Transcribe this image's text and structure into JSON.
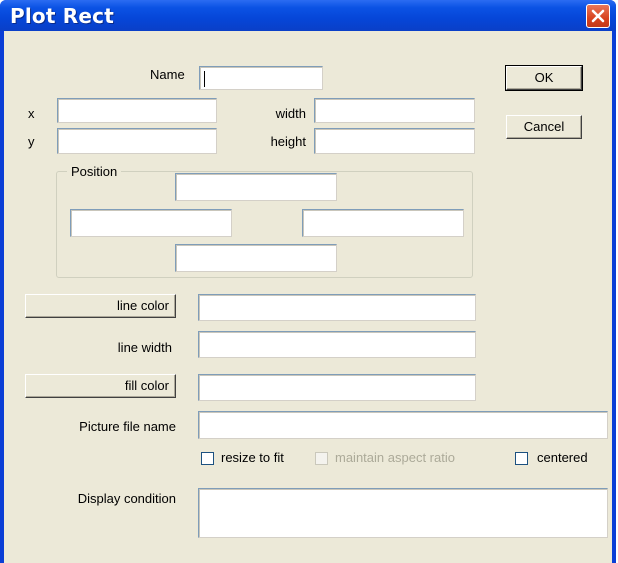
{
  "window": {
    "title": "Plot Rect"
  },
  "form": {
    "name_label": "Name",
    "name_value": "",
    "x_label": "x",
    "x_value": "",
    "y_label": "y",
    "y_value": "",
    "width_label": "width",
    "width_value": "",
    "height_label": "height",
    "height_value": ""
  },
  "position": {
    "legend": "Position",
    "top_value": "",
    "left_value": "",
    "right_value": "",
    "bottom_value": ""
  },
  "buttons": {
    "ok": "OK",
    "cancel": "Cancel",
    "line_color": "line color",
    "fill_color": "fill color"
  },
  "appearance": {
    "line_color_value": "",
    "line_width_label": "line width",
    "line_width_value": "",
    "fill_color_value": ""
  },
  "picture": {
    "file_label": "Picture file name",
    "file_value": "",
    "resize_to_fit": {
      "label": "resize to fit",
      "checked": false,
      "enabled": true
    },
    "maintain_aspect_ratio": {
      "label": "maintain aspect ratio",
      "checked": false,
      "enabled": false
    },
    "centered": {
      "label": "centered",
      "checked": false,
      "enabled": true
    }
  },
  "display": {
    "condition_label": "Display condition",
    "condition_value": ""
  },
  "colors": {
    "titlebar": "#0b52e4",
    "dialog_bg": "#ece9d8",
    "close_button": "#d8431f",
    "field_border": "#7f9db9",
    "disabled_text": "#acaa99"
  },
  "icons": {
    "close": "close-x-icon"
  }
}
